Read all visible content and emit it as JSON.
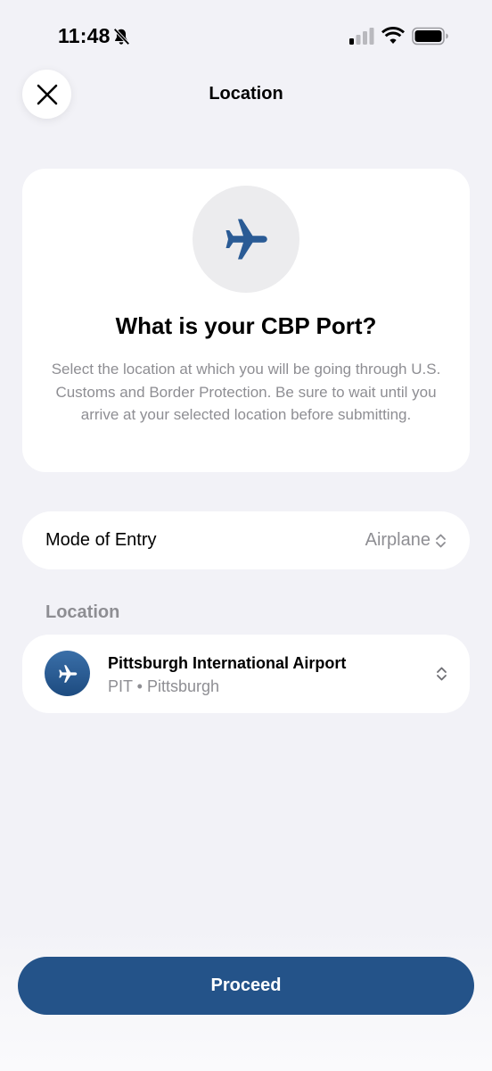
{
  "status_bar": {
    "time": "11:48",
    "icons": [
      "bell-slash-icon",
      "signal-icon",
      "wifi-icon",
      "battery-icon"
    ]
  },
  "nav": {
    "title": "Location",
    "close_icon": "close-icon"
  },
  "hero": {
    "icon": "airplane-icon",
    "title": "What is your CBP Port?",
    "description": "Select the location at which you will be going through U.S. Customs and Border Protection. Be sure to wait until you arrive at your selected location before submitting."
  },
  "mode_of_entry": {
    "label": "Mode of Entry",
    "value": "Airplane",
    "icon": "chevron-up-down-icon"
  },
  "location_section": {
    "header": "Location",
    "selected": {
      "name": "Pittsburgh International Airport",
      "subtitle": "PIT • Pittsburgh",
      "icon": "airplane-icon"
    }
  },
  "actions": {
    "proceed_label": "Proceed"
  },
  "colors": {
    "background": "#f2f2f7",
    "card": "#ffffff",
    "accent": "#245389",
    "icon_blue": "#2a5b95",
    "secondary_text": "#8e8e93"
  }
}
